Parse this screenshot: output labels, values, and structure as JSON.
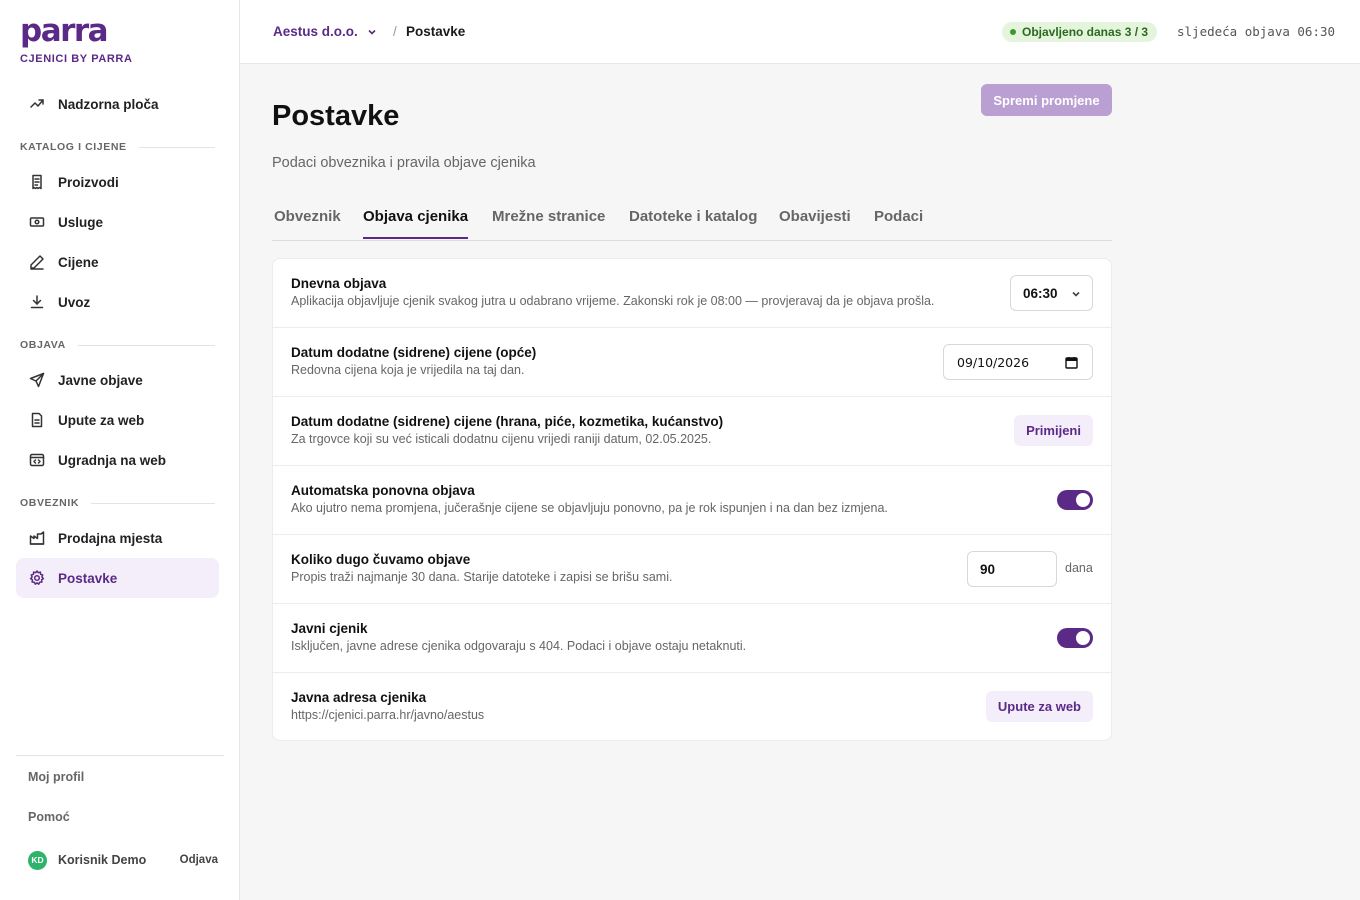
{
  "brand": {
    "logo": "parra",
    "subtitle": "CJENICI BY PARRA",
    "accent": "#5b2a86"
  },
  "sidebar": {
    "dashboard": "Nadzorna ploča",
    "sections": [
      {
        "title": "KATALOG I CIJENE",
        "items": [
          "Proizvodi",
          "Usluge",
          "Cijene",
          "Uvoz"
        ]
      },
      {
        "title": "OBJAVA",
        "items": [
          "Javne objave",
          "Upute za web",
          "Ugradnja na web"
        ]
      },
      {
        "title": "OBVEZNIK",
        "items": [
          "Prodajna mjesta",
          "Postavke"
        ]
      }
    ],
    "footer": {
      "profile": "Moj profil",
      "help": "Pomoć",
      "initials": "KD",
      "user": "Korisnik Demo",
      "logout": "Odjava"
    }
  },
  "topbar": {
    "company": "Aestus d.o.o.",
    "separator": "/",
    "current": "Postavke",
    "status": "Objavljeno danas 3 / 3",
    "next": "sljedeća objava 06:30"
  },
  "main": {
    "save": "Spremi promjene",
    "title": "Postavke",
    "subtitle": "Podaci obveznika i pravila objave cjenika",
    "tabs": [
      "Obveznik",
      "Objava cjenika",
      "Mrežne stranice",
      "Datoteke i katalog",
      "Obavijesti",
      "Podaci"
    ],
    "active_tab": "Objava cjenika"
  },
  "settings": {
    "daily": {
      "title": "Dnevna objava",
      "desc": "Aplikacija objavljuje cjenik svakog jutra u odabrano vrijeme. Zakonski rok je 08:00 — provjeravaj da je objava prošla.",
      "value": "06:30"
    },
    "anchor_general": {
      "title": "Datum dodatne (sidrene) cijene (opće)",
      "desc": "Redovna cijena koja je vrijedila na taj dan.",
      "value": "09/10/2026"
    },
    "anchor_food": {
      "title": "Datum dodatne (sidrene) cijene (hrana, piće, kozmetika, kućanstvo)",
      "desc": "Za trgovce koji su već isticali dodatnu cijenu vrijedi raniji datum, 02.05.2025.",
      "button": "Primijeni"
    },
    "auto_republish": {
      "title": "Automatska ponovna objava",
      "desc": "Ako ujutro nema promjena, jučerašnje cijene se objavljuju ponovno, pa je rok ispunjen i na dan bez izmjena.",
      "enabled": true
    },
    "retention": {
      "title": "Koliko dugo čuvamo objave",
      "desc": "Propis traži najmanje 30 dana. Starije datoteke i zapisi se brišu sami.",
      "value": "90",
      "unit": "dana"
    },
    "public": {
      "title": "Javni cjenik",
      "desc": "Isključen, javne adrese cjenika odgovaraju s 404. Podaci i objave ostaju netaknuti.",
      "enabled": true
    },
    "public_url": {
      "title": "Javna adresa cjenika",
      "desc": "https://cjenici.parra.hr/javno/aestus",
      "button": "Upute za web"
    }
  }
}
